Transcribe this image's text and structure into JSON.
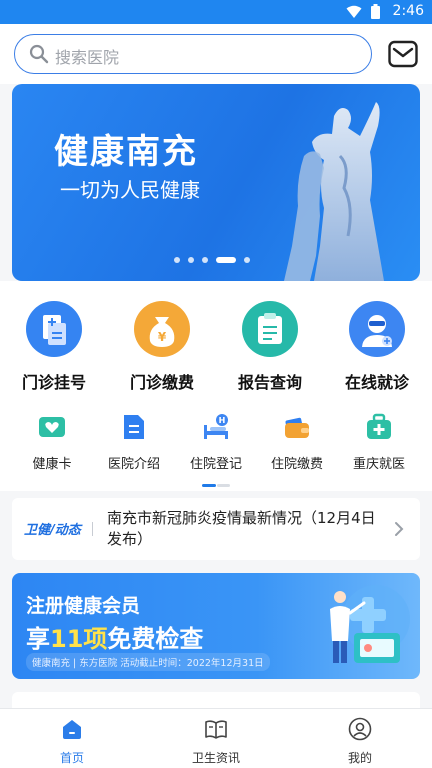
{
  "status_bar": {
    "time": "2:46"
  },
  "search": {
    "placeholder": "搜索医院"
  },
  "banner": {
    "title": "健康南充",
    "subtitle": "一切为人民健康",
    "slide_count": 5,
    "active_slide": 4
  },
  "main_services": [
    {
      "label": "门诊挂号",
      "icon": "registration-icon",
      "color": "#2f7ff0"
    },
    {
      "label": "门诊缴费",
      "icon": "payment-bag-icon",
      "color": "#f2a233"
    },
    {
      "label": "报告查询",
      "icon": "report-clipboard-icon",
      "color": "#25b9a8"
    },
    {
      "label": "在线就诊",
      "icon": "doctor-icon",
      "color": "#3d86f2"
    }
  ],
  "sub_services": [
    {
      "label": "健康卡",
      "icon": "health-card-icon",
      "color": "#2dbfa5"
    },
    {
      "label": "医院介绍",
      "icon": "hospital-doc-icon",
      "color": "#2f7ff0"
    },
    {
      "label": "住院登记",
      "icon": "hospital-bed-icon",
      "color": "#3d86f2"
    },
    {
      "label": "住院缴费",
      "icon": "wallet-icon",
      "color": "#f2a233"
    },
    {
      "label": "重庆就医",
      "icon": "medkit-icon",
      "color": "#2dbfa5"
    }
  ],
  "news": {
    "tag": "卫健/动态",
    "text": "南充市新冠肺炎疫情最新情况（12月4日发布）"
  },
  "promo": {
    "line1": "注册健康会员",
    "line2_pre": "享",
    "line2_highlight": "11项",
    "line2_post": "免费检查",
    "footer": "健康南充 | 东方医院  活动截止时间：2022年12月31日"
  },
  "tabs": [
    {
      "label": "首页",
      "icon": "home-icon",
      "active": true
    },
    {
      "label": "卫生资讯",
      "icon": "book-icon",
      "active": false
    },
    {
      "label": "我的",
      "icon": "profile-icon",
      "active": false
    }
  ],
  "colors": {
    "brand": "#1f86f0",
    "active_tab": "#2b7de9"
  }
}
